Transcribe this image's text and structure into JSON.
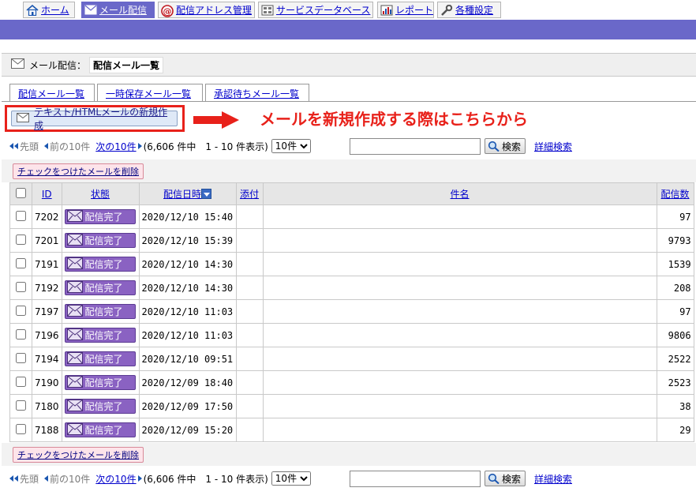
{
  "nav": {
    "items": [
      {
        "label": "ホーム",
        "icon": "home-icon"
      },
      {
        "label": "メール配信",
        "icon": "mail-icon",
        "active": true
      },
      {
        "label": "配信アドレス管理",
        "icon": "at-icon"
      },
      {
        "label": "サービスデータベース",
        "icon": "database-icon"
      },
      {
        "label": "レポート",
        "icon": "chart-icon"
      },
      {
        "label": "各種設定",
        "icon": "wrench-icon"
      }
    ]
  },
  "header": {
    "section": "メール配信：",
    "current": "配信メール一覧"
  },
  "tabs": [
    {
      "label": "配信メール一覧"
    },
    {
      "label": "一時保存メール一覧"
    },
    {
      "label": "承認待ちメール一覧"
    }
  ],
  "create": {
    "button_label": "テキスト/HTMLメールの新規作成",
    "callout": "メールを新規作成する際はこちらから"
  },
  "pager": {
    "first": "先頭",
    "prev": "前の10件",
    "next": "次の10件",
    "summary": "(6,606 件中　1 - 10 件表示)",
    "per_page": "10件",
    "search_value": "",
    "search_button": "検索",
    "advanced": "詳細検索"
  },
  "delete_button": "チェックをつけたメールを削除",
  "table": {
    "headers": {
      "id": "ID",
      "status": "状態",
      "date": "配信日時",
      "attach": "添付",
      "subject": "件名",
      "count": "配信数"
    },
    "rows": [
      {
        "id": "7202",
        "status": "配信完了",
        "date": "2020/12/10 15:40",
        "subject": "",
        "count": "97"
      },
      {
        "id": "7201",
        "status": "配信完了",
        "date": "2020/12/10 15:39",
        "subject": "",
        "count": "9793"
      },
      {
        "id": "7191",
        "status": "配信完了",
        "date": "2020/12/10 14:30",
        "subject": "",
        "count": "1539"
      },
      {
        "id": "7192",
        "status": "配信完了",
        "date": "2020/12/10 14:30",
        "subject": "",
        "count": "208"
      },
      {
        "id": "7197",
        "status": "配信完了",
        "date": "2020/12/10 11:03",
        "subject": "",
        "count": "97"
      },
      {
        "id": "7196",
        "status": "配信完了",
        "date": "2020/12/10 11:03",
        "subject": "",
        "count": "9806"
      },
      {
        "id": "7194",
        "status": "配信完了",
        "date": "2020/12/10 09:51",
        "subject": "",
        "count": "2522"
      },
      {
        "id": "7190",
        "status": "配信完了",
        "date": "2020/12/09 18:40",
        "subject": "",
        "count": "2523"
      },
      {
        "id": "7180",
        "status": "配信完了",
        "date": "2020/12/09 17:50",
        "subject": "",
        "count": "38"
      },
      {
        "id": "7188",
        "status": "配信完了",
        "date": "2020/12/09 15:20",
        "subject": "",
        "count": "29"
      }
    ]
  },
  "colors": {
    "accent": "#6a68c9",
    "highlight": "#e8211a",
    "badge": "#8a62c2"
  }
}
